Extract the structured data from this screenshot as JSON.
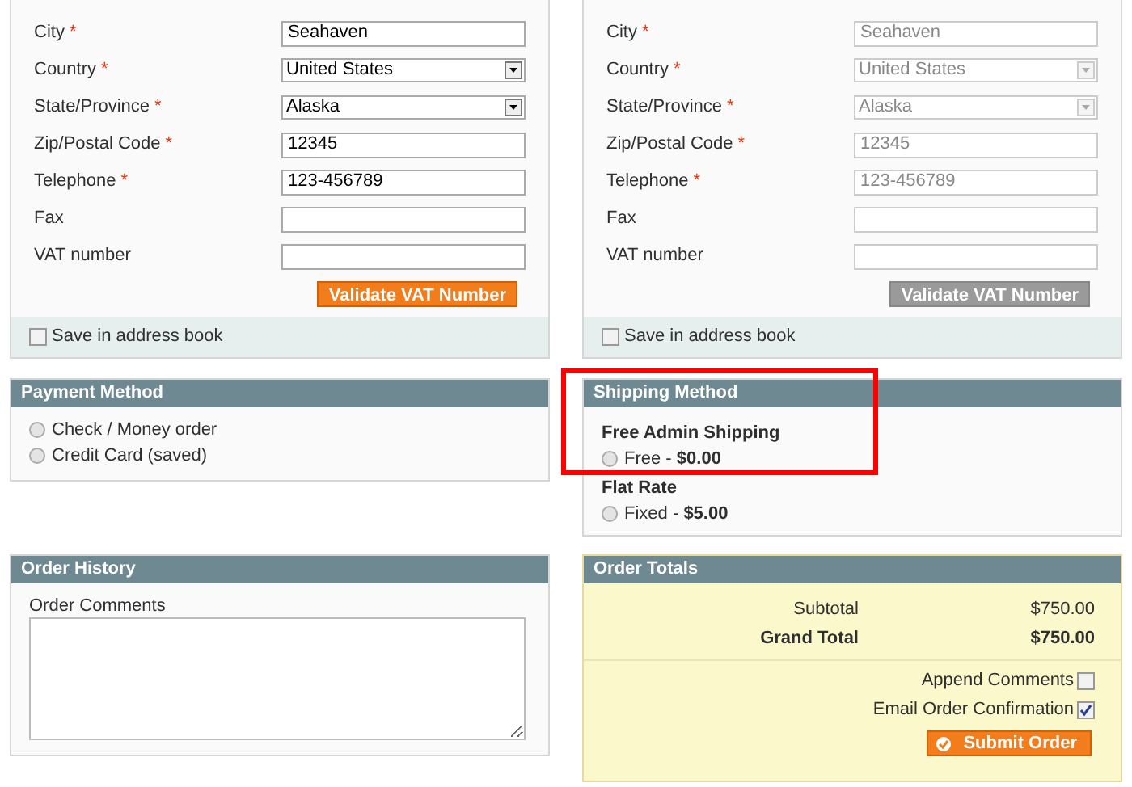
{
  "addresses": [
    {
      "disabled": false,
      "fields": [
        {
          "label": "City",
          "required_mark": "*",
          "kind": "text",
          "value": "Seahaven"
        },
        {
          "label": "Country",
          "required_mark": "*",
          "kind": "select",
          "value": "United States"
        },
        {
          "label": "State/Province",
          "required_mark": "*",
          "kind": "select",
          "value": "Alaska"
        },
        {
          "label": "Zip/Postal Code",
          "required_mark": "*",
          "kind": "text",
          "value": "12345"
        },
        {
          "label": "Telephone",
          "required_mark": "*",
          "kind": "text",
          "value": "123-456789"
        },
        {
          "label": "Fax",
          "kind": "text"
        },
        {
          "label": "VAT number",
          "kind": "text"
        }
      ],
      "validate_button": "Validate VAT Number",
      "save_in_address_book": {
        "label": "Save in address book",
        "checked": false
      }
    },
    {
      "disabled": true,
      "fields": [
        {
          "label": "City",
          "required_mark": "*",
          "kind": "text",
          "value": "Seahaven"
        },
        {
          "label": "Country",
          "required_mark": "*",
          "kind": "select",
          "value": "United States"
        },
        {
          "label": "State/Province",
          "required_mark": "*",
          "kind": "select",
          "value": "Alaska"
        },
        {
          "label": "Zip/Postal Code",
          "required_mark": "*",
          "kind": "text",
          "value": "12345"
        },
        {
          "label": "Telephone",
          "required_mark": "*",
          "kind": "text",
          "value": "123-456789"
        },
        {
          "label": "Fax",
          "kind": "text"
        },
        {
          "label": "VAT number",
          "kind": "text"
        }
      ],
      "validate_button": "Validate VAT Number",
      "save_in_address_book": {
        "label": "Save in address book",
        "checked": false
      }
    }
  ],
  "payment_method": {
    "title": "Payment Method",
    "options": [
      {
        "label": "Check / Money order",
        "selected": false
      },
      {
        "label": "Credit Card (saved)",
        "selected": false
      }
    ]
  },
  "shipping_method": {
    "title": "Shipping Method",
    "highlighted": true,
    "carriers": [
      {
        "name": "Free Admin Shipping",
        "options": [
          {
            "label": "Free -",
            "price": "$0.00",
            "selected": false
          }
        ]
      },
      {
        "name": "Flat Rate",
        "options": [
          {
            "label": "Fixed -",
            "price": "$5.00",
            "selected": false
          }
        ]
      }
    ]
  },
  "order_history": {
    "title": "Order History",
    "comments_label": "Order Comments"
  },
  "order_totals": {
    "title": "Order Totals",
    "rows": [
      {
        "kind": "subtotal",
        "label": "Subtotal",
        "value": "$750.00"
      },
      {
        "kind": "grand",
        "label": "Grand Total",
        "value": "$750.00"
      }
    ],
    "options": [
      {
        "label": "Append Comments",
        "checked": false
      },
      {
        "label": "Email Order Confirmation",
        "checked": true
      }
    ],
    "submit_button": "Submit Order"
  }
}
